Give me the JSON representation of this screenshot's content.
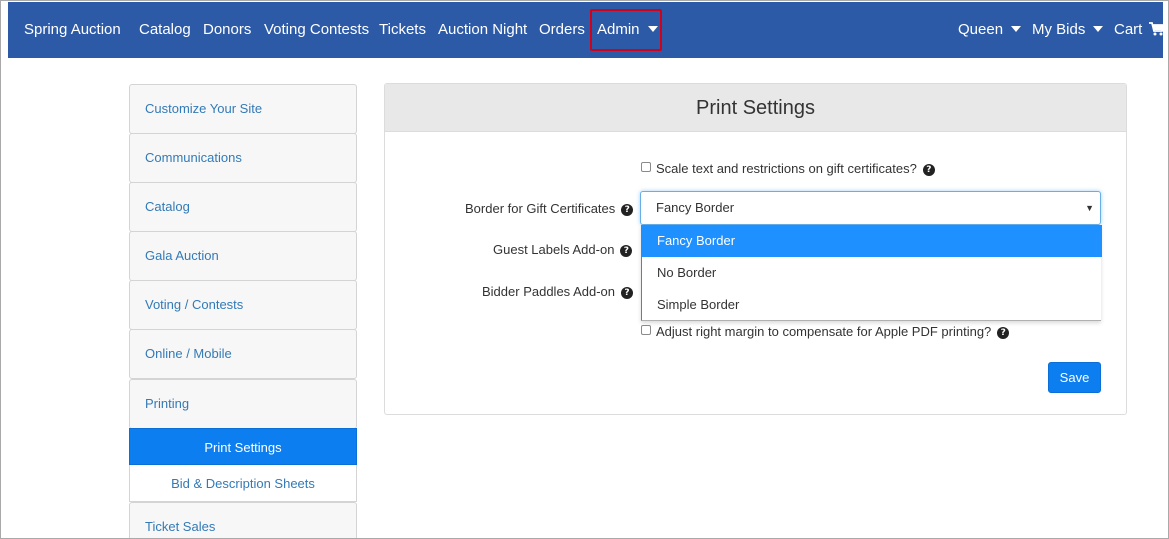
{
  "navbar": {
    "brand": "Spring Auction",
    "items": [
      "Catalog",
      "Donors",
      "Voting Contests",
      "Tickets",
      "Auction Night",
      "Orders",
      "Admin"
    ],
    "right": {
      "user": "Queen",
      "bids": "My Bids",
      "cart": "Cart"
    }
  },
  "sidebar": {
    "items": [
      "Customize Your Site",
      "Communications",
      "Catalog",
      "Gala Auction",
      "Voting / Contests",
      "Online / Mobile",
      "Printing"
    ],
    "sub_items": [
      "Print Settings",
      "Bid & Description Sheets"
    ],
    "after": "Ticket Sales"
  },
  "panel": {
    "title": "Print Settings",
    "scale_text_label": "Scale text and restrictions on gift certificates?",
    "border_label": "Border for Gift Certificates",
    "border_value": "Fancy Border",
    "border_options": [
      "Fancy Border",
      "No Border",
      "Simple Border"
    ],
    "guest_labels_label": "Guest Labels Add-on",
    "bidder_paddles_label": "Bidder Paddles Add-on",
    "apple_margin_label": "Adjust right margin to compensate for Apple PDF printing?",
    "save_label": "Save"
  },
  "colors": {
    "navbar_bg": "#2d5aa7",
    "accent": "#0d7ef0",
    "highlight_outline": "#d0021b",
    "link": "#337ab7"
  }
}
